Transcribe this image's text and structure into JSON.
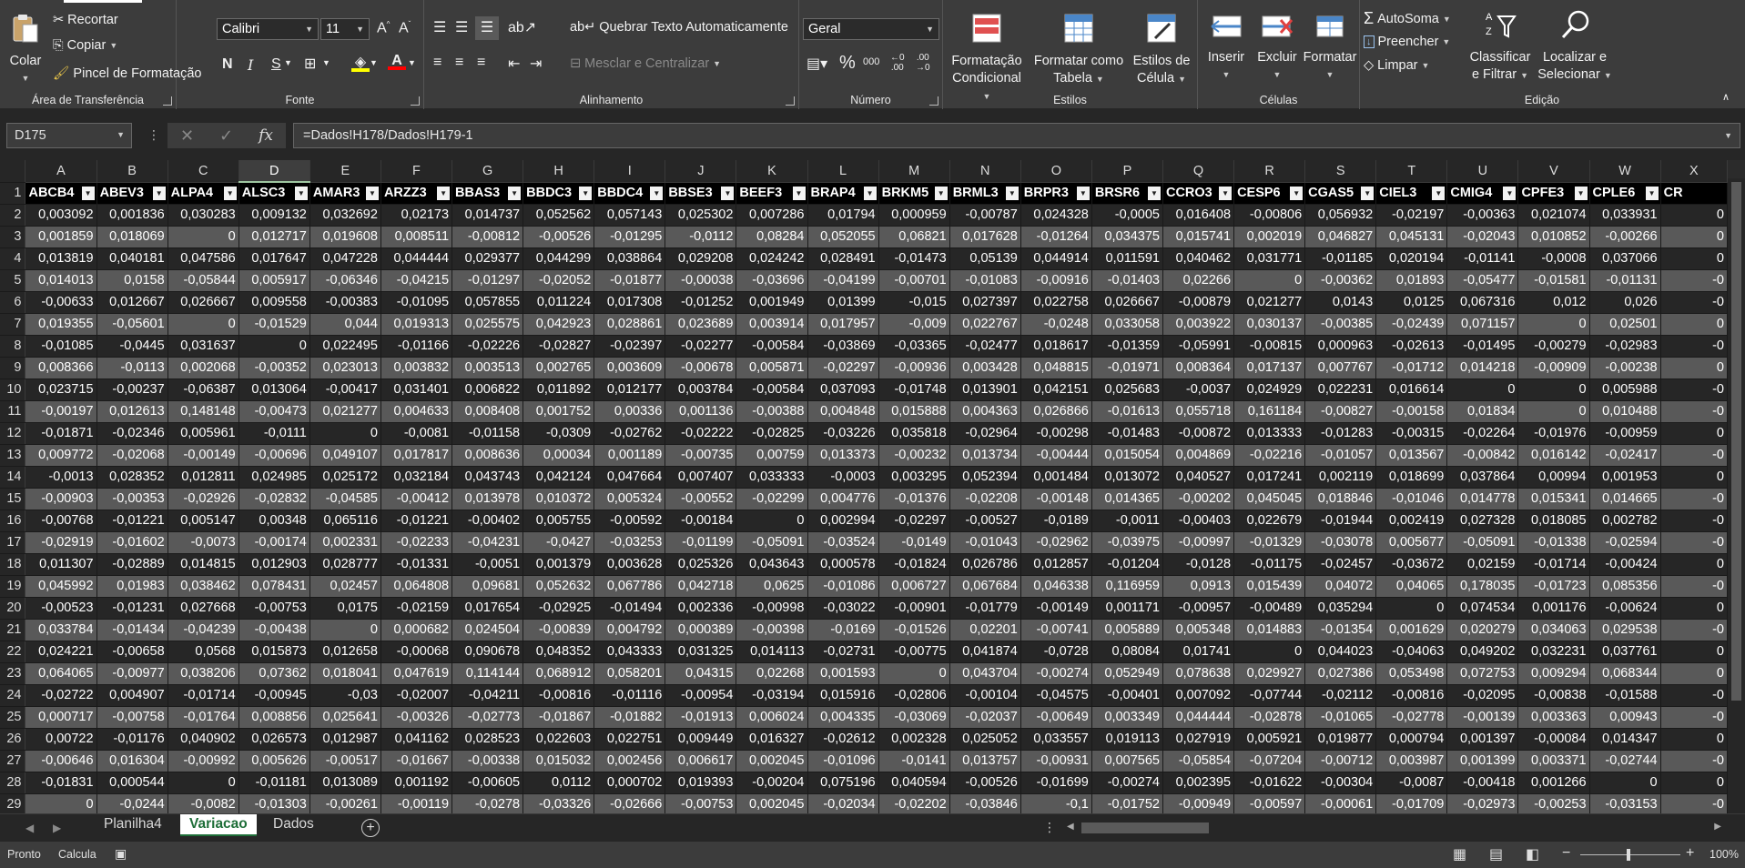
{
  "ribbon": {
    "clipboard": {
      "paste": "Colar",
      "cut": "Recortar",
      "copy": "Copiar",
      "format_painter": "Pincel de Formatação",
      "label": "Área de Transferência"
    },
    "font": {
      "name": "Calibri",
      "size": "11",
      "label": "Fonte",
      "bold": "N",
      "italic": "I",
      "underline": "S"
    },
    "alignment": {
      "wrap_text": "Quebrar Texto Automaticamente",
      "merge_center": "Mesclar e Centralizar",
      "label": "Alinhamento"
    },
    "number": {
      "format": "Geral",
      "label": "Número"
    },
    "styles": {
      "conditional": [
        "Formatação",
        "Condicional"
      ],
      "format_table": [
        "Formatar como",
        "Tabela"
      ],
      "cell_styles": [
        "Estilos de",
        "Célula"
      ],
      "label": "Estilos"
    },
    "cells": {
      "insert": "Inserir",
      "delete": "Excluir",
      "format": "Formatar",
      "label": "Células"
    },
    "editing": {
      "autosum": "AutoSoma",
      "fill": "Preencher",
      "clear": "Limpar",
      "sort_filter": [
        "Classificar",
        "e Filtrar"
      ],
      "find_select": [
        "Localizar e",
        "Selecionar"
      ],
      "label": "Edição"
    }
  },
  "formula_bar": {
    "name_box": "D175",
    "formula": "=Dados!H178/Dados!H179-1"
  },
  "grid": {
    "selected_column": "D",
    "columns": [
      "A",
      "B",
      "C",
      "D",
      "E",
      "F",
      "G",
      "H",
      "I",
      "J",
      "K",
      "L",
      "M",
      "N",
      "O",
      "P",
      "Q",
      "R",
      "S",
      "T",
      "U",
      "V",
      "W",
      "X"
    ],
    "headers": [
      "ABCB4",
      "ABEV3",
      "ALPA4",
      "ALSC3",
      "AMAR3",
      "ARZZ3",
      "BBAS3",
      "BBDC3",
      "BBDC4",
      "BBSE3",
      "BEEF3",
      "BRAP4",
      "BRKM5",
      "BRML3",
      "BRPR3",
      "BRSR6",
      "CCRO3",
      "CESP6",
      "CGAS5",
      "CIEL3",
      "CMIG4",
      "CPFE3",
      "CPLE6",
      "CR"
    ],
    "rows": [
      {
        "n": "2",
        "c": [
          "0,003092",
          "0,001836",
          "0,030283",
          "0,009132",
          "0,032692",
          "0,02173",
          "0,014737",
          "0,052562",
          "0,057143",
          "0,025302",
          "0,007286",
          "0,01794",
          "0,000959",
          "-0,00787",
          "0,024328",
          "-0,0005",
          "0,016408",
          "-0,00806",
          "0,056932",
          "-0,02197",
          "-0,00363",
          "0,021074",
          "0,033931",
          "0"
        ]
      },
      {
        "n": "3",
        "c": [
          "0,001859",
          "0,018069",
          "0",
          "0,012717",
          "0,019608",
          "0,008511",
          "-0,00812",
          "-0,00526",
          "-0,01295",
          "-0,0112",
          "0,08284",
          "0,052055",
          "0,06821",
          "0,017628",
          "-0,01264",
          "0,034375",
          "0,015741",
          "0,002019",
          "0,046827",
          "0,045131",
          "-0,02043",
          "0,010852",
          "-0,00266",
          "0"
        ]
      },
      {
        "n": "4",
        "c": [
          "0,013819",
          "0,040181",
          "0,047586",
          "0,017647",
          "0,047228",
          "0,044444",
          "0,029377",
          "0,044299",
          "0,038864",
          "0,029208",
          "0,024242",
          "0,028491",
          "-0,01473",
          "0,05139",
          "0,044914",
          "0,011591",
          "0,040462",
          "0,031771",
          "-0,01185",
          "0,020194",
          "-0,01141",
          "-0,0008",
          "0,037066",
          "0"
        ]
      },
      {
        "n": "5",
        "c": [
          "0,014013",
          "0,0158",
          "-0,05844",
          "0,005917",
          "-0,06346",
          "-0,04215",
          "-0,01297",
          "-0,02052",
          "-0,01877",
          "-0,00038",
          "-0,03696",
          "-0,04199",
          "-0,00701",
          "-0,01083",
          "-0,00916",
          "-0,01403",
          "0,02266",
          "0",
          "-0,00362",
          "0,01893",
          "-0,05477",
          "-0,01581",
          "-0,01131",
          "-0"
        ]
      },
      {
        "n": "6",
        "c": [
          "-0,00633",
          "0,012667",
          "0,026667",
          "0,009558",
          "-0,00383",
          "-0,01095",
          "0,057855",
          "0,011224",
          "0,017308",
          "-0,01252",
          "0,001949",
          "0,01399",
          "-0,015",
          "0,027397",
          "0,022758",
          "0,026667",
          "-0,00879",
          "0,021277",
          "0,0143",
          "0,0125",
          "0,067316",
          "0,012",
          "0,026",
          "-0"
        ]
      },
      {
        "n": "7",
        "c": [
          "0,019355",
          "-0,05601",
          "0",
          "-0,01529",
          "0,044",
          "0,019313",
          "0,025575",
          "0,042923",
          "0,028861",
          "0,023689",
          "0,003914",
          "0,017957",
          "-0,009",
          "0,022767",
          "-0,0248",
          "0,033058",
          "0,003922",
          "0,030137",
          "-0,00385",
          "-0,02439",
          "0,071157",
          "0",
          "0,02501",
          "0"
        ]
      },
      {
        "n": "8",
        "c": [
          "-0,01085",
          "-0,0445",
          "0,031637",
          "0",
          "0,022495",
          "-0,01166",
          "-0,02226",
          "-0,02827",
          "-0,02397",
          "-0,02277",
          "-0,00584",
          "-0,03869",
          "-0,03365",
          "-0,02477",
          "0,018617",
          "-0,01359",
          "-0,05991",
          "-0,00815",
          "0,000963",
          "-0,02613",
          "-0,01495",
          "-0,00279",
          "-0,02983",
          "-0"
        ]
      },
      {
        "n": "9",
        "c": [
          "0,008366",
          "-0,0113",
          "0,002068",
          "-0,00352",
          "0,023013",
          "0,003832",
          "0,003513",
          "0,002765",
          "0,003609",
          "-0,00678",
          "0,005871",
          "-0,02297",
          "-0,00936",
          "0,003428",
          "0,048815",
          "-0,01971",
          "0,008364",
          "0,017137",
          "0,007767",
          "-0,01712",
          "0,014218",
          "-0,00909",
          "-0,00238",
          "0"
        ]
      },
      {
        "n": "10",
        "c": [
          "0,023715",
          "-0,00237",
          "-0,06387",
          "0,013064",
          "-0,00417",
          "0,031401",
          "0,006822",
          "0,011892",
          "0,012177",
          "0,003784",
          "-0,00584",
          "0,037093",
          "-0,01748",
          "0,013901",
          "0,042151",
          "0,025683",
          "-0,0037",
          "0,024929",
          "0,022231",
          "0,016614",
          "0",
          "0",
          "0,005988",
          "-0"
        ]
      },
      {
        "n": "11",
        "c": [
          "-0,00197",
          "0,012613",
          "0,148148",
          "-0,00473",
          "0,021277",
          "0,004633",
          "0,008408",
          "0,001752",
          "0,00336",
          "0,001136",
          "-0,00388",
          "0,004848",
          "0,015888",
          "0,004363",
          "0,026866",
          "-0,01613",
          "0,055718",
          "0,161184",
          "-0,00827",
          "-0,00158",
          "0,01834",
          "0",
          "0,010488",
          "-0"
        ]
      },
      {
        "n": "12",
        "c": [
          "-0,01871",
          "-0,02346",
          "0,005961",
          "-0,0111",
          "0",
          "-0,0081",
          "-0,01158",
          "-0,0309",
          "-0,02762",
          "-0,02222",
          "-0,02825",
          "-0,03226",
          "0,035818",
          "-0,02964",
          "-0,00298",
          "-0,01483",
          "-0,00872",
          "0,013333",
          "-0,01283",
          "-0,00315",
          "-0,02264",
          "-0,01976",
          "-0,00959",
          "0"
        ]
      },
      {
        "n": "13",
        "c": [
          "0,009772",
          "-0,02068",
          "-0,00149",
          "-0,00696",
          "0,049107",
          "0,017817",
          "0,008636",
          "0,00034",
          "0,001189",
          "-0,00735",
          "0,00759",
          "0,013373",
          "-0,00232",
          "0,013734",
          "-0,00444",
          "0,015054",
          "0,004869",
          "-0,02216",
          "-0,01057",
          "0,013567",
          "-0,00842",
          "0,016142",
          "-0,02417",
          "-0"
        ]
      },
      {
        "n": "14",
        "c": [
          "-0,0013",
          "0,028352",
          "0,012811",
          "0,024985",
          "0,025172",
          "0,032184",
          "0,043743",
          "0,042124",
          "0,047664",
          "0,007407",
          "0,033333",
          "-0,0003",
          "0,003295",
          "0,052394",
          "0,001484",
          "0,013072",
          "0,040527",
          "0,017241",
          "0,002119",
          "0,018699",
          "0,037864",
          "0,00994",
          "0,001953",
          "0"
        ]
      },
      {
        "n": "15",
        "c": [
          "-0,00903",
          "-0,00353",
          "-0,02926",
          "-0,02832",
          "-0,04585",
          "-0,00412",
          "0,013978",
          "0,010372",
          "0,005324",
          "-0,00552",
          "-0,02299",
          "0,004776",
          "-0,01376",
          "-0,02208",
          "-0,00148",
          "0,014365",
          "-0,00202",
          "0,045045",
          "0,018846",
          "-0,01046",
          "0,014778",
          "0,015341",
          "0,014665",
          "-0"
        ]
      },
      {
        "n": "16",
        "c": [
          "-0,00768",
          "-0,01221",
          "0,005147",
          "0,00348",
          "0,065116",
          "-0,01221",
          "-0,00402",
          "0,005755",
          "-0,00592",
          "-0,00184",
          "0",
          "0,002994",
          "-0,02297",
          "-0,00527",
          "-0,0189",
          "-0,0011",
          "-0,00403",
          "0,022679",
          "-0,01944",
          "0,002419",
          "0,027328",
          "0,018085",
          "0,002782",
          "-0"
        ]
      },
      {
        "n": "17",
        "c": [
          "-0,02919",
          "-0,01602",
          "-0,0073",
          "-0,00174",
          "0,002331",
          "-0,02233",
          "-0,04231",
          "-0,0427",
          "-0,03253",
          "-0,01199",
          "-0,05091",
          "-0,03524",
          "-0,0149",
          "-0,01043",
          "-0,02962",
          "-0,03975",
          "-0,00997",
          "-0,01329",
          "-0,03078",
          "0,005677",
          "-0,05091",
          "-0,01338",
          "-0,02594",
          "-0"
        ]
      },
      {
        "n": "18",
        "c": [
          "0,011307",
          "-0,02889",
          "0,014815",
          "0,012903",
          "0,028777",
          "-0,01331",
          "-0,0051",
          "0,001379",
          "0,003628",
          "0,025326",
          "0,043643",
          "0,000578",
          "-0,01824",
          "0,026786",
          "0,012857",
          "-0,01204",
          "-0,0128",
          "-0,01175",
          "-0,02457",
          "-0,03672",
          "0,02159",
          "-0,01714",
          "-0,00424",
          "0"
        ]
      },
      {
        "n": "19",
        "c": [
          "0,045992",
          "0,01983",
          "0,038462",
          "0,078431",
          "0,02457",
          "0,064808",
          "0,09681",
          "0,052632",
          "0,067786",
          "0,042718",
          "0,0625",
          "-0,01086",
          "0,006727",
          "0,067684",
          "0,046338",
          "0,116959",
          "0,0913",
          "0,015439",
          "0,04072",
          "0,04065",
          "0,178035",
          "-0,01723",
          "0,085356",
          "-0"
        ]
      },
      {
        "n": "20",
        "c": [
          "-0,00523",
          "-0,01231",
          "0,027668",
          "-0,00753",
          "0,0175",
          "-0,02159",
          "0,017654",
          "-0,02925",
          "-0,01494",
          "0,002336",
          "-0,00998",
          "-0,03022",
          "-0,00901",
          "-0,01779",
          "-0,00149",
          "0,001171",
          "-0,00957",
          "-0,00489",
          "0,035294",
          "0",
          "0,074534",
          "0,001176",
          "-0,00624",
          "0"
        ]
      },
      {
        "n": "21",
        "c": [
          "0,033784",
          "-0,01434",
          "-0,04239",
          "-0,00438",
          "0",
          "0,000682",
          "0,024504",
          "-0,00839",
          "0,004792",
          "0,000389",
          "-0,00398",
          "-0,0169",
          "-0,01526",
          "0,02201",
          "-0,00741",
          "0,005889",
          "0,005348",
          "0,014883",
          "-0,01354",
          "0,001629",
          "0,020279",
          "0,034063",
          "0,029538",
          "-0"
        ]
      },
      {
        "n": "22",
        "c": [
          "0,024221",
          "-0,00658",
          "0,0568",
          "0,015873",
          "0,012658",
          "-0,00068",
          "0,090678",
          "0,048352",
          "0,043333",
          "0,031325",
          "0,014113",
          "-0,02731",
          "-0,00775",
          "0,041874",
          "-0,0728",
          "0,08084",
          "0,01741",
          "0",
          "0,044023",
          "-0,04063",
          "0,049202",
          "0,032231",
          "0,037761",
          "0"
        ]
      },
      {
        "n": "23",
        "c": [
          "0,064065",
          "-0,00977",
          "0,038206",
          "0,07362",
          "0,018041",
          "0,047619",
          "0,114144",
          "0,068912",
          "0,058201",
          "0,04315",
          "0,02268",
          "0,001593",
          "0",
          "0,043704",
          "-0,00274",
          "0,052949",
          "0,078638",
          "0,029927",
          "0,027386",
          "0,053498",
          "0,072753",
          "0,009294",
          "0,068344",
          "0"
        ]
      },
      {
        "n": "24",
        "c": [
          "-0,02722",
          "0,004907",
          "-0,01714",
          "-0,00945",
          "-0,03",
          "-0,02007",
          "-0,04211",
          "-0,00816",
          "-0,01116",
          "-0,00954",
          "-0,03194",
          "0,015916",
          "-0,02806",
          "-0,00104",
          "-0,04575",
          "-0,00401",
          "0,007092",
          "-0,07744",
          "-0,02112",
          "-0,00816",
          "-0,02095",
          "-0,00838",
          "-0,01588",
          "-0"
        ]
      },
      {
        "n": "25",
        "c": [
          "0,000717",
          "-0,00758",
          "-0,01764",
          "0,008856",
          "0,025641",
          "-0,00326",
          "-0,02773",
          "-0,01867",
          "-0,01882",
          "-0,01913",
          "0,006024",
          "0,004335",
          "-0,03069",
          "-0,02037",
          "-0,00649",
          "0,003349",
          "0,044444",
          "-0,02878",
          "-0,01065",
          "-0,02778",
          "-0,00139",
          "0,003363",
          "0,00943",
          "-0"
        ]
      },
      {
        "n": "26",
        "c": [
          "0,00722",
          "-0,01176",
          "0,040902",
          "0,026573",
          "0,012987",
          "0,041162",
          "0,028523",
          "0,022603",
          "0,022751",
          "0,009449",
          "0,016327",
          "-0,02612",
          "0,002328",
          "0,025052",
          "0,033557",
          "0,019113",
          "0,027919",
          "0,005921",
          "0,019877",
          "0,000794",
          "0,001397",
          "-0,00084",
          "0,014347",
          "0"
        ]
      },
      {
        "n": "27",
        "c": [
          "-0,00646",
          "0,016304",
          "-0,00992",
          "0,005626",
          "-0,00517",
          "-0,01667",
          "-0,00338",
          "0,015032",
          "0,002456",
          "0,006617",
          "0,002045",
          "-0,01096",
          "-0,0141",
          "0,013757",
          "-0,00931",
          "0,007565",
          "-0,05854",
          "-0,07204",
          "-0,00712",
          "0,003987",
          "0,001399",
          "0,003371",
          "-0,02744",
          "-0"
        ]
      },
      {
        "n": "28",
        "c": [
          "-0,01831",
          "0,000544",
          "0",
          "-0,01181",
          "0,013089",
          "0,001192",
          "-0,00605",
          "0,0112",
          "0,000702",
          "0,019393",
          "-0,00204",
          "0,075196",
          "0,040594",
          "-0,00526",
          "-0,01699",
          "-0,00274",
          "0,002395",
          "-0,01622",
          "-0,00304",
          "-0,0087",
          "-0,00418",
          "0,001266",
          "0",
          "0"
        ]
      },
      {
        "n": "29",
        "c": [
          "0",
          "-0,0244",
          "-0,0082",
          "-0,01303",
          "-0,00261",
          "-0,00119",
          "-0,0278",
          "-0,03326",
          "-0,02666",
          "-0,00753",
          "0,002045",
          "-0,02034",
          "-0,02202",
          "-0,03846",
          "-0,1",
          "-0,01752",
          "-0,00949",
          "-0,00597",
          "-0,00061",
          "-0,01709",
          "-0,02973",
          "-0,00253",
          "-0,03153",
          "-0"
        ]
      }
    ]
  },
  "sheets": {
    "tabs": [
      "Planilha4",
      "Variacao",
      "Dados"
    ],
    "active": "Variacao"
  },
  "status": {
    "ready": "Pronto",
    "calc": "Calcula",
    "zoom": "100%"
  },
  "colors": {
    "ribbon_bg": "#3c3c3c",
    "grid_bg": "#262626",
    "band_light": "#595959",
    "band_dark": "#262626",
    "active_tab": "#1e6e38"
  }
}
